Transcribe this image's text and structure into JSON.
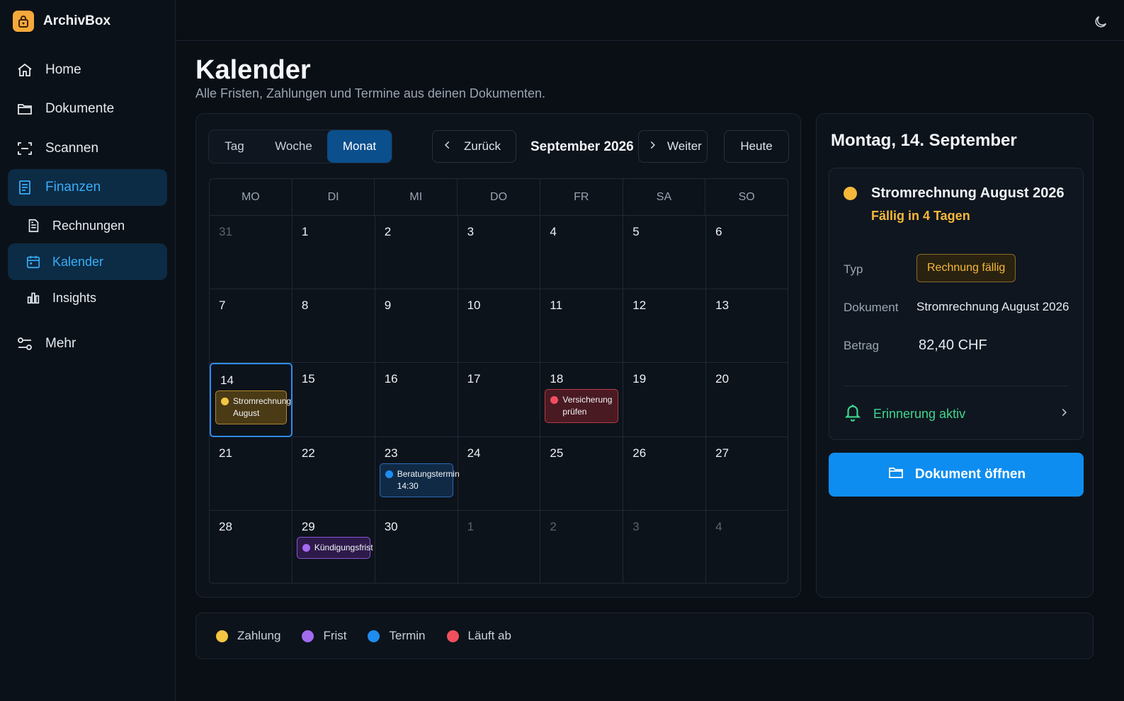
{
  "app": {
    "name": "ArchivBox"
  },
  "sidebar": {
    "items": [
      {
        "label": "Home",
        "icon": "home-icon"
      },
      {
        "label": "Dokumente",
        "icon": "folder-icon"
      },
      {
        "label": "Scannen",
        "icon": "scan-icon"
      },
      {
        "label": "Finanzen",
        "icon": "receipt-icon",
        "active": true
      },
      {
        "label": "Rechnungen",
        "icon": "invoice-icon",
        "sub": true
      },
      {
        "label": "Kalender",
        "icon": "calendar-icon",
        "sub": true,
        "active": true
      },
      {
        "label": "Insights",
        "icon": "bar-chart-icon",
        "sub": true
      },
      {
        "label": "Mehr",
        "icon": "sliders-icon"
      }
    ]
  },
  "header": {
    "title": "Kalender",
    "subtitle": "Alle Fristen, Zahlungen und Termine aus deinen Dokumenten."
  },
  "toolbar": {
    "views": [
      "Tag",
      "Woche",
      "Monat"
    ],
    "active_view": "Monat",
    "back_label": "Zurück",
    "month_label": "September 2026",
    "next_label": "Weiter",
    "today_label": "Heute"
  },
  "calendar": {
    "weekdays": [
      "MO",
      "DI",
      "MI",
      "DO",
      "FR",
      "SA",
      "SO"
    ],
    "weeks": [
      [
        {
          "d": "31",
          "m": true
        },
        {
          "d": "1"
        },
        {
          "d": "2"
        },
        {
          "d": "3"
        },
        {
          "d": "4"
        },
        {
          "d": "5"
        },
        {
          "d": "6"
        }
      ],
      [
        {
          "d": "7"
        },
        {
          "d": "8"
        },
        {
          "d": "9"
        },
        {
          "d": "10"
        },
        {
          "d": "11"
        },
        {
          "d": "12"
        },
        {
          "d": "13"
        }
      ],
      [
        {
          "d": "14",
          "sel": true
        },
        {
          "d": "15"
        },
        {
          "d": "16"
        },
        {
          "d": "17"
        },
        {
          "d": "18"
        },
        {
          "d": "19"
        },
        {
          "d": "20"
        }
      ],
      [
        {
          "d": "21"
        },
        {
          "d": "22"
        },
        {
          "d": "23"
        },
        {
          "d": "24"
        },
        {
          "d": "25"
        },
        {
          "d": "26"
        },
        {
          "d": "27"
        }
      ],
      [
        {
          "d": "28"
        },
        {
          "d": "29"
        },
        {
          "d": "30"
        },
        {
          "d": "1",
          "m": true
        },
        {
          "d": "2",
          "m": true
        },
        {
          "d": "3",
          "m": true
        },
        {
          "d": "4",
          "m": true
        }
      ]
    ],
    "events": [
      {
        "week": 2,
        "day": 0,
        "lines": [
          "Stromrechnung",
          "August"
        ],
        "type": "pay"
      },
      {
        "week": 2,
        "day": 4,
        "lines": [
          "Versicherung",
          "prüfen"
        ],
        "type": "exp"
      },
      {
        "week": 3,
        "day": 2,
        "lines": [
          "Beratungstermin",
          "14:30"
        ],
        "type": "term"
      },
      {
        "week": 4,
        "day": 1,
        "lines": [
          "Kündigungsfrist"
        ],
        "type": "frist"
      }
    ]
  },
  "detail": {
    "date_title": "Montag, 14. September",
    "event_title": "Stromrechnung August 2026",
    "due_text": "Fällig in 4 Tagen",
    "type_label": "Typ",
    "type_badge": "Rechnung fällig",
    "doc_label": "Dokument",
    "doc_value": "Stromrechnung August 2026",
    "amount_label": "Betrag",
    "amount_value": "82,40 CHF",
    "reminder_label": "Erinnerung aktiv",
    "open_button": "Dokument öffnen"
  },
  "legend": [
    {
      "label": "Zahlung",
      "color": "#f5c542"
    },
    {
      "label": "Frist",
      "color": "#a36bf0"
    },
    {
      "label": "Termin",
      "color": "#1e8cf0"
    },
    {
      "label": "Läuft ab",
      "color": "#f0505c"
    }
  ],
  "colors": {
    "pay": "#f5c542",
    "exp": "#f0505c",
    "term": "#1e8cf0",
    "frist": "#a36bf0",
    "accent": "#0e8df0"
  }
}
